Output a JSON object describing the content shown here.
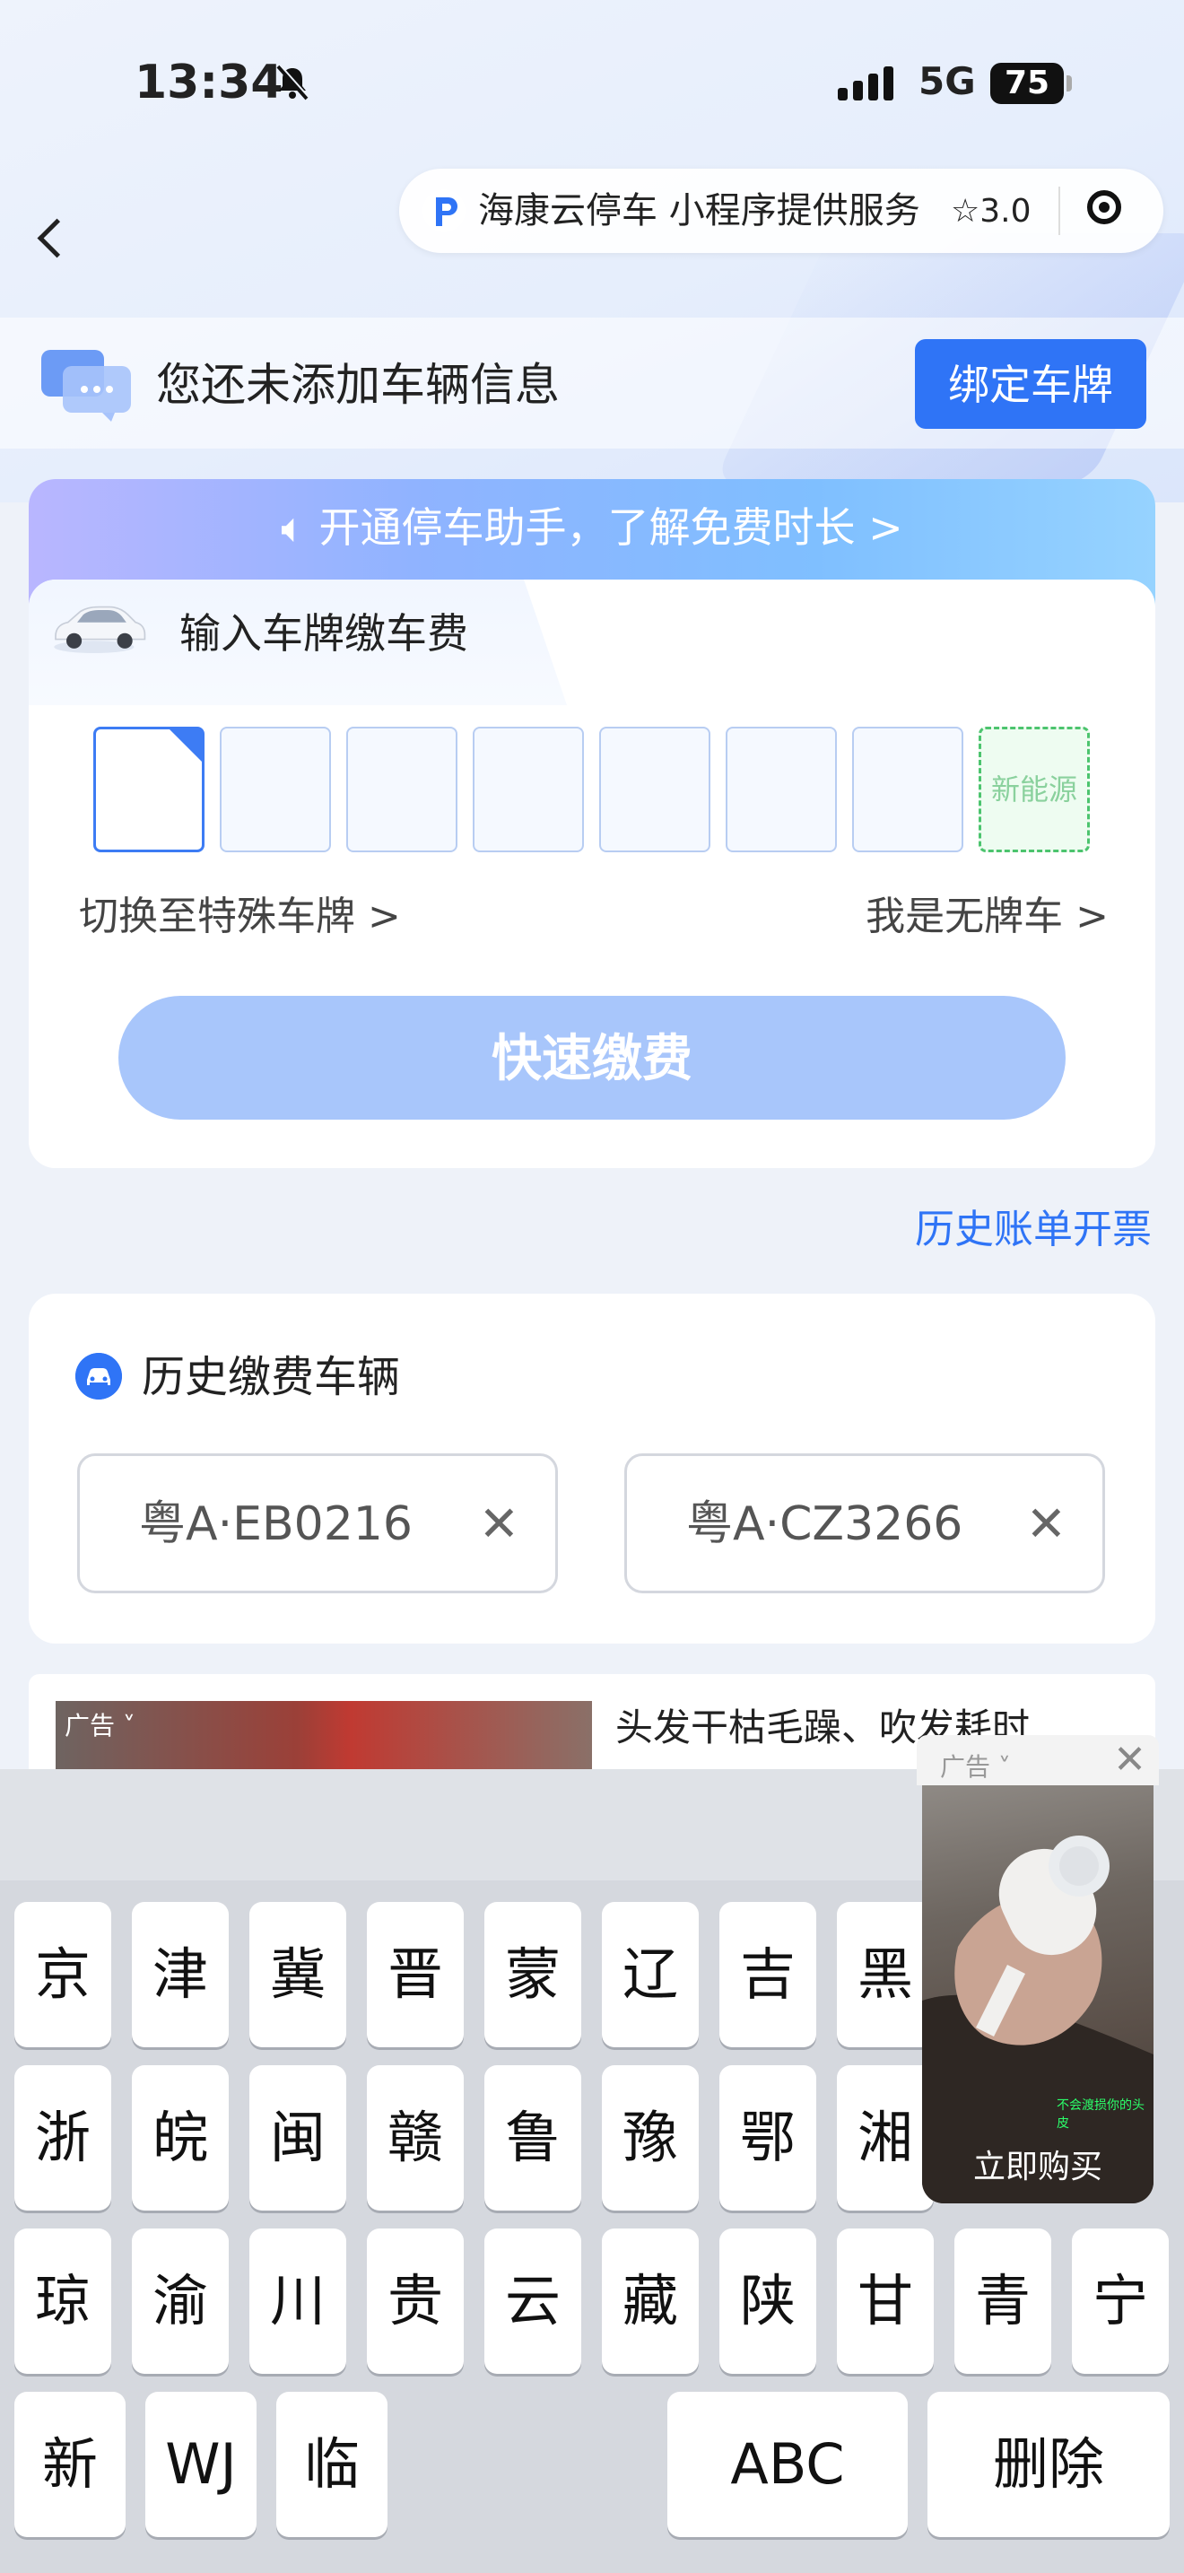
{
  "status_bar": {
    "time": "13:34",
    "network": "5G",
    "battery": "75"
  },
  "mini_program": {
    "capsule_text": "海康云停车 小程序提供服务",
    "rating": "3.0"
  },
  "vehicle_banner": {
    "message": "您还未添加车辆信息",
    "bind_button": "绑定车牌"
  },
  "payment_card": {
    "tip": "开通停车助手，了解免费时长 >",
    "tab_label": "输入车牌缴车费",
    "plate_slots": [
      "",
      "",
      "",
      "",
      "",
      "",
      ""
    ],
    "new_energy_label": "新能源",
    "switch_special": "切换至特殊车牌 >",
    "no_plate": "我是无牌车 >",
    "pay_button": "快速缴费"
  },
  "history_invoice_link": "历史账单开票",
  "history_vehicles": {
    "title": "历史缴费车辆",
    "plates": [
      {
        "plate": "粤A·EB0216"
      },
      {
        "plate": "粤A·CZ3266"
      }
    ]
  },
  "ad_banner": {
    "tag": "广告 ˅",
    "title": "头发干枯毛躁、吹发耗时"
  },
  "floating_ad": {
    "tag": "广告 ˅",
    "buy_label": "立即购买",
    "caption": "不会渡损你的头皮"
  },
  "keyboard": {
    "row1": [
      "京",
      "津",
      "冀",
      "晋",
      "蒙",
      "辽",
      "吉",
      "黑"
    ],
    "row2": [
      "浙",
      "皖",
      "闽",
      "赣",
      "鲁",
      "豫",
      "鄂",
      "湘"
    ],
    "row3": [
      "琼",
      "渝",
      "川",
      "贵",
      "云",
      "藏",
      "陕",
      "甘",
      "青",
      "宁"
    ],
    "row4": [
      "新",
      "WJ",
      "临"
    ],
    "abc_key": "ABC",
    "delete_key": "删除"
  },
  "colors": {
    "accent": "#2f74f6",
    "pay_disabled": "#a8c6fb",
    "new_energy": "#4cc46e"
  }
}
